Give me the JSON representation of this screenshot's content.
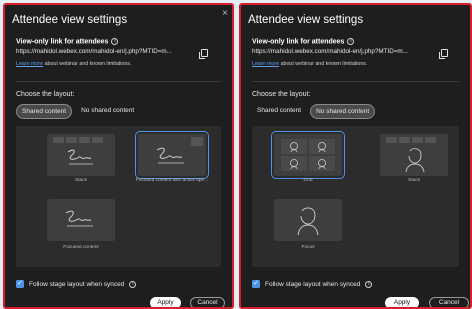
{
  "dialog": {
    "title": "Attendee view settings",
    "close_glyph": "×",
    "view_link_title": "View-only link for attendees",
    "info_glyph": "i",
    "view_link_url": "https://mahidol.webex.com/mahidol-en/j.php?MTID=m...",
    "learn_link": "Learn more",
    "learn_text": " about webinar and known limitations.",
    "choose_layout": "Choose the layout:",
    "follow_stage": "Follow stage layout when synced",
    "apply": "Apply",
    "cancel": "Cancel",
    "check_glyph": "✓"
  },
  "panel_left": {
    "tabs": [
      {
        "label": "Shared content",
        "selected": true
      },
      {
        "label": "No shared content",
        "selected": false
      }
    ],
    "layouts": [
      {
        "label": "Stack",
        "selected": false
      },
      {
        "label": "Focused content with active spe...",
        "selected": true
      },
      {
        "label": "Focused content",
        "selected": false
      }
    ]
  },
  "panel_right": {
    "tabs": [
      {
        "label": "Shared content",
        "selected": false
      },
      {
        "label": "No shared content",
        "selected": true
      }
    ],
    "layouts": [
      {
        "label": "Grid",
        "selected": true
      },
      {
        "label": "Stack",
        "selected": false
      },
      {
        "label": "Focus",
        "selected": false
      }
    ]
  },
  "colors": {
    "accent": "#4d93ec",
    "panel_bg": "#1e1e1e",
    "frame": "#d81e2a"
  },
  "icons": [
    "close-icon",
    "info-icon",
    "copy-icon",
    "signature-icon",
    "person-icon",
    "checkbox-icon"
  ]
}
